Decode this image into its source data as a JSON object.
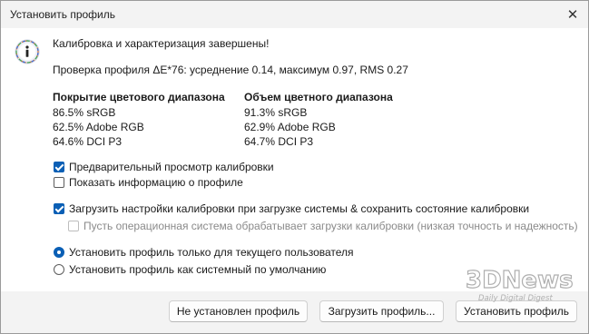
{
  "window": {
    "title": "Установить профиль",
    "close_glyph": "✕"
  },
  "message": {
    "icon": "info-icon",
    "heading": "Калибровка и характеризация завершены!",
    "verification": "Проверка профиля ΔE*76: усреднение 0.14, максимум 0.97, RMS 0.27"
  },
  "coverage": {
    "header": "Покрытие цветового диапазона",
    "rows": [
      "86.5% sRGB",
      "62.5% Adobe RGB",
      "64.6% DCI P3"
    ]
  },
  "volume": {
    "header": "Объем цветного диапазона",
    "rows": [
      "91.3% sRGB",
      "62.9% Adobe RGB",
      "64.7% DCI P3"
    ]
  },
  "options": {
    "preview_label": "Предварительный просмотр калибровки",
    "preview_checked": true,
    "show_info_label": "Показать информацию о профиле",
    "show_info_checked": false,
    "load_calibration_label": "Загрузить настройки калибровки при загрузке системы & сохранить состояние калибровки",
    "load_calibration_checked": true,
    "os_handles_label": "Пусть операционная система обрабатывает загрузки калибровки (низкая точность и надежность)",
    "os_handles_checked": false,
    "os_handles_enabled": false,
    "install_current_user_label": "Установить профиль только для текущего пользователя",
    "install_system_default_label": "Установить профиль как системный по умолчанию",
    "install_scope_selected": "current_user"
  },
  "buttons": {
    "dont_install": "Не установлен профиль",
    "load_profile": "Загрузить профиль...",
    "install_profile": "Установить профиль"
  },
  "watermark": {
    "logo_text": "3DNews",
    "tagline": "Daily Digital Digest"
  },
  "colors": {
    "accent": "#0a5fb5",
    "info_icon_ring": "#e1e6f5"
  }
}
